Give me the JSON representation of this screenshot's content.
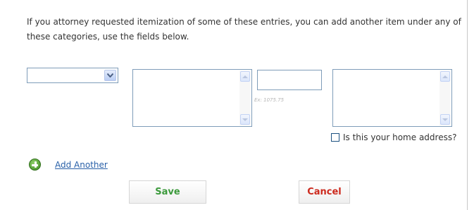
{
  "intro_text": "If you attorney requested itemization of some of these entries, you can add another item under any of these categories, use the fields below.",
  "category_select": {
    "selected": ""
  },
  "description": {
    "value": ""
  },
  "amount": {
    "value": "",
    "hint": "Ex: 1075.75"
  },
  "address": {
    "value": "",
    "home_address_label": "Is this your home address?"
  },
  "add_another_label": "Add Another",
  "save_label": "Save",
  "cancel_label": "Cancel",
  "icons": {
    "add": "plus-circle-icon",
    "dropdown": "chevron-down-icon"
  },
  "colors": {
    "link": "#2960a8",
    "save_text": "#3c9a3c",
    "cancel_text": "#cc2a1e",
    "add_icon": "#4ca42a"
  }
}
